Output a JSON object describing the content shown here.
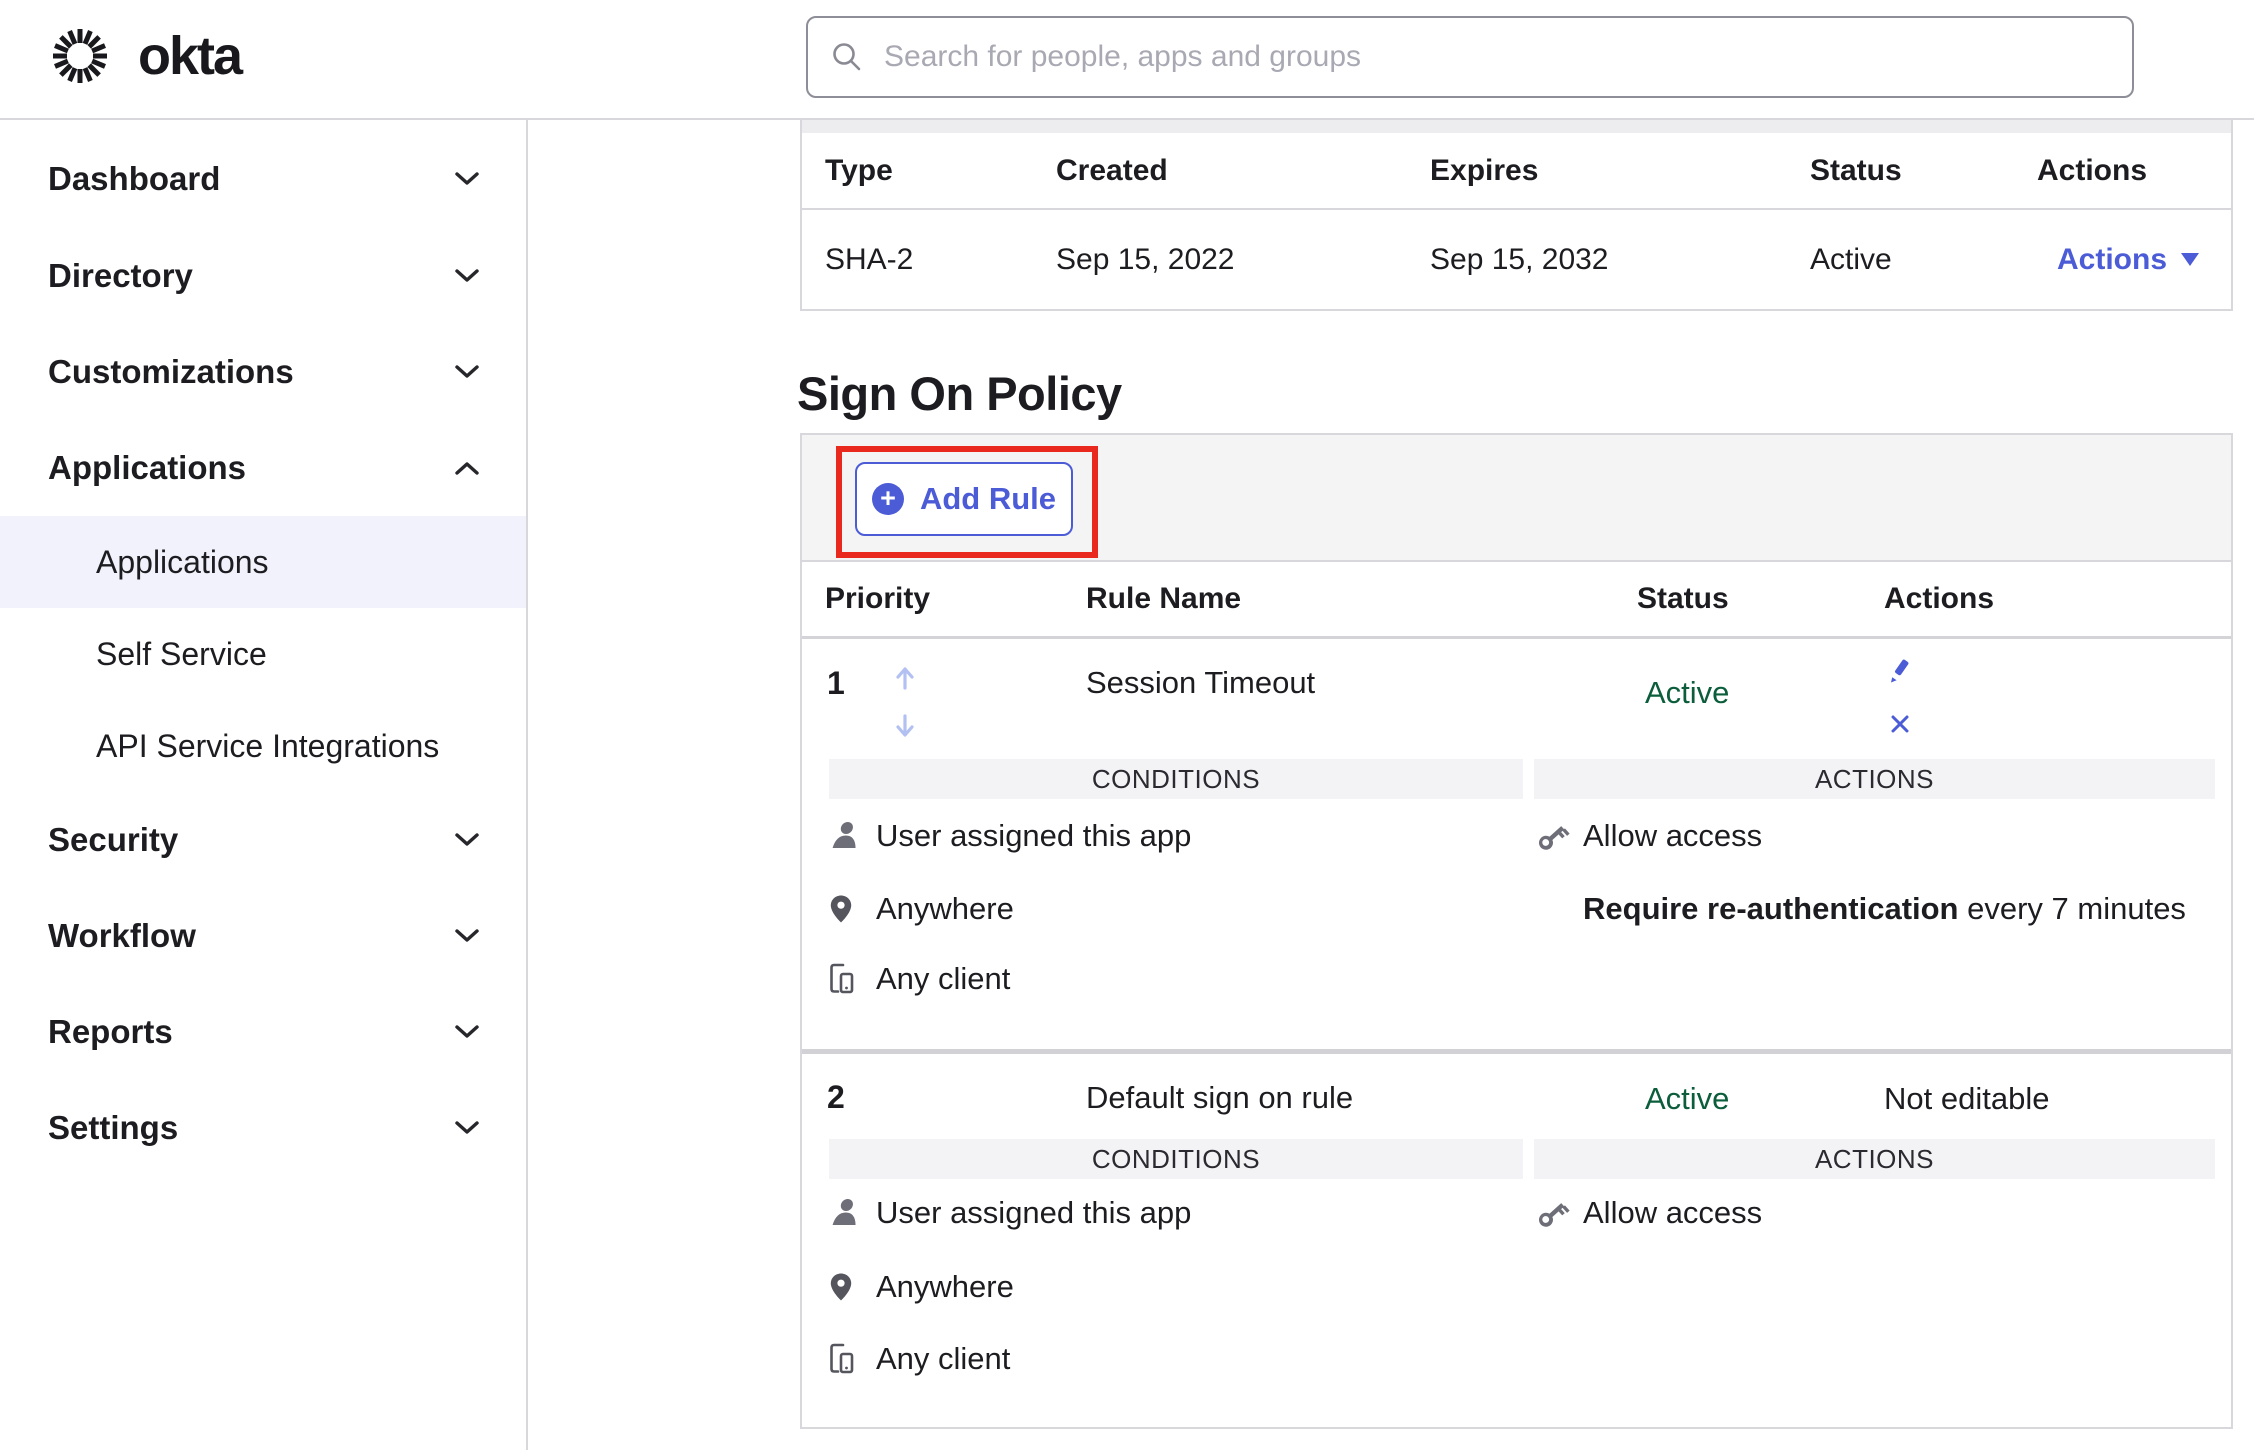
{
  "header": {
    "brand": "okta",
    "search": {
      "placeholder": "Search for people, apps and groups"
    }
  },
  "sidebar": {
    "items": [
      {
        "label": "Dashboard"
      },
      {
        "label": "Directory"
      },
      {
        "label": "Customizations"
      },
      {
        "label": "Applications"
      },
      {
        "label": "Security"
      },
      {
        "label": "Workflow"
      },
      {
        "label": "Reports"
      },
      {
        "label": "Settings"
      }
    ],
    "applications_children": [
      {
        "label": "Applications"
      },
      {
        "label": "Self Service"
      },
      {
        "label": "API Service Integrations"
      }
    ]
  },
  "certificates": {
    "columns": {
      "type": "Type",
      "created": "Created",
      "expires": "Expires",
      "status": "Status",
      "actions": "Actions"
    },
    "row": {
      "type": "SHA-2",
      "created": "Sep 15, 2022",
      "expires": "Sep 15, 2032",
      "status": "Active",
      "actions": "Actions"
    }
  },
  "sign_on_policy": {
    "title": "Sign On Policy",
    "add_rule_label": "Add Rule",
    "columns": {
      "priority": "Priority",
      "rule_name": "Rule Name",
      "status": "Status",
      "actions": "Actions"
    },
    "section_labels": {
      "conditions": "CONDITIONS",
      "actions": "ACTIONS"
    },
    "rules": [
      {
        "priority": "1",
        "name": "Session Timeout",
        "status": "Active",
        "conditions": [
          "User assigned this app",
          "Anywhere",
          "Any client"
        ],
        "actions": {
          "allow": "Allow access",
          "reauth_bold": "Require re-authentication",
          "reauth_rest": " every 7 minutes"
        }
      },
      {
        "priority": "2",
        "name": "Default sign on rule",
        "status": "Active",
        "actions_note": "Not editable",
        "conditions": [
          "User assigned this app",
          "Anywhere",
          "Any client"
        ],
        "actions": {
          "allow": "Allow access"
        }
      }
    ]
  },
  "colors": {
    "accent_blue": "#4b5cd6",
    "success_green": "#0b5d3b",
    "annotation_red": "#e9281e",
    "sidebar_highlight": "#f1f2fb"
  }
}
